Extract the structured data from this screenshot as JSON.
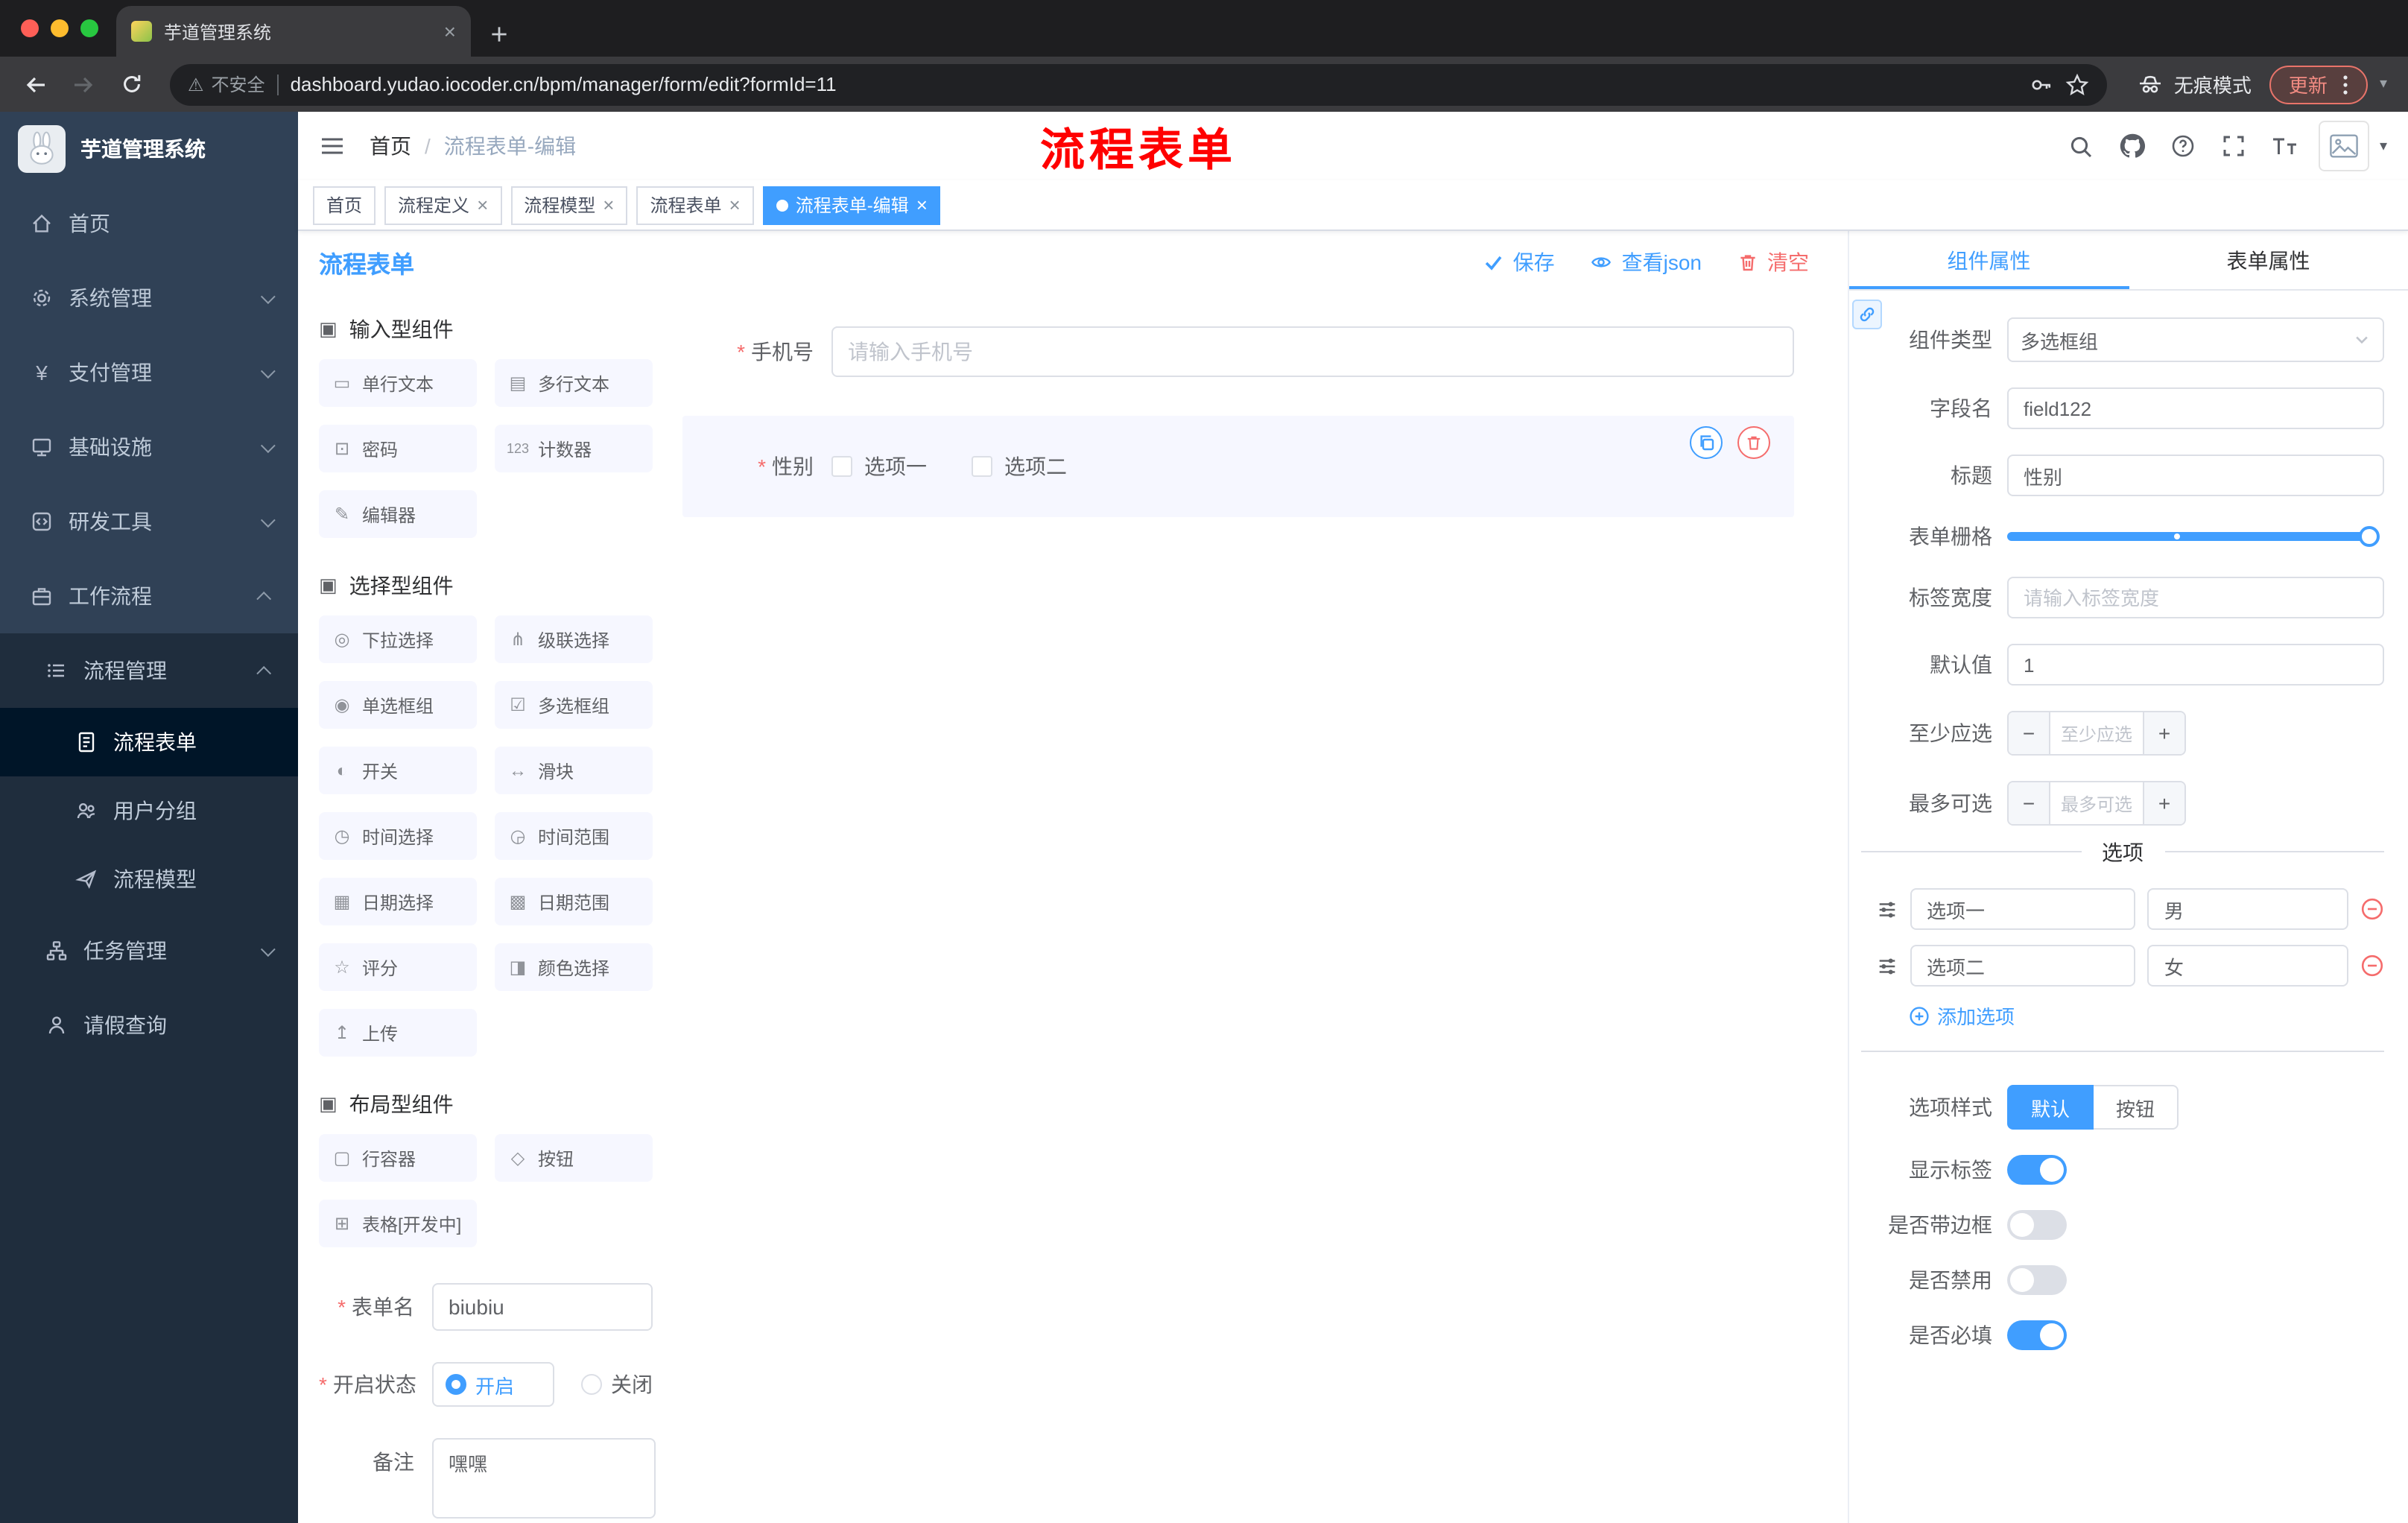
{
  "glyphs": {
    "close": "×",
    "caret_down": "▾",
    "warning": "⚠",
    "minus": "−",
    "plus": "+",
    "yen": "¥"
  },
  "browser": {
    "tab_title": "芋道管理系统",
    "security_label": "不安全",
    "url": "dashboard.yudao.iocoder.cn/bpm/manager/form/edit?formId=11",
    "incognito_label": "无痕模式",
    "update_label": "更新"
  },
  "sidebar": {
    "brand": "芋道管理系统",
    "items": [
      {
        "label": "首页"
      },
      {
        "label": "系统管理"
      },
      {
        "label": "支付管理"
      },
      {
        "label": "基础设施"
      },
      {
        "label": "研发工具"
      },
      {
        "label": "工作流程"
      },
      {
        "label": "流程管理"
      },
      {
        "label": "流程表单"
      },
      {
        "label": "用户分组"
      },
      {
        "label": "流程模型"
      },
      {
        "label": "任务管理"
      },
      {
        "label": "请假查询"
      }
    ]
  },
  "header": {
    "breadcrumb": {
      "home": "首页",
      "sep": "/",
      "current": "流程表单-编辑"
    },
    "annotation": "流程表单"
  },
  "tags": [
    {
      "label": "首页"
    },
    {
      "label": "流程定义"
    },
    {
      "label": "流程模型"
    },
    {
      "label": "流程表单"
    },
    {
      "label": "流程表单-编辑"
    }
  ],
  "designer": {
    "title": "流程表单",
    "actions": {
      "save": "保存",
      "view_json": "查看json",
      "clear": "清空"
    },
    "palette": {
      "sections": [
        {
          "title": "输入型组件",
          "glyph": "▣",
          "items": [
            {
              "glyph": "▭",
              "label": "单行文本"
            },
            {
              "glyph": "▤",
              "label": "多行文本"
            },
            {
              "glyph": "⊡",
              "label": "密码"
            },
            {
              "glyph": "123",
              "label": "计数器"
            },
            {
              "glyph": "✎",
              "label": "编辑器"
            }
          ]
        },
        {
          "title": "选择型组件",
          "glyph": "▣",
          "items": [
            {
              "glyph": "◎",
              "label": "下拉选择"
            },
            {
              "glyph": "⋔",
              "label": "级联选择"
            },
            {
              "glyph": "◉",
              "label": "单选框组"
            },
            {
              "glyph": "☑",
              "label": "多选框组"
            },
            {
              "glyph": "◐",
              "label": "开关"
            },
            {
              "glyph": "↔",
              "label": "滑块"
            },
            {
              "glyph": "◷",
              "label": "时间选择"
            },
            {
              "glyph": "◶",
              "label": "时间范围"
            },
            {
              "glyph": "▦",
              "label": "日期选择"
            },
            {
              "glyph": "▩",
              "label": "日期范围"
            },
            {
              "glyph": "☆",
              "label": "评分"
            },
            {
              "glyph": "◨",
              "label": "颜色选择"
            },
            {
              "glyph": "↥",
              "label": "上传"
            }
          ]
        },
        {
          "title": "布局型组件",
          "glyph": "▣",
          "items": [
            {
              "glyph": "▢",
              "label": "行容器"
            },
            {
              "glyph": "◇",
              "label": "按钮"
            },
            {
              "glyph": "⊞",
              "label": "表格[开发中]"
            }
          ]
        }
      ]
    },
    "meta_form": {
      "name_label": "表单名",
      "name_value": "biubiu",
      "status_label": "开启状态",
      "status_on": "开启",
      "status_off": "关闭",
      "remark_label": "备注",
      "remark_value": "嘿嘿"
    },
    "canvas": {
      "phone": {
        "label": "手机号",
        "placeholder": "请输入手机号"
      },
      "gender": {
        "label": "性别",
        "options": [
          {
            "label": "选项一"
          },
          {
            "label": "选项二"
          }
        ]
      }
    }
  },
  "props": {
    "tabs": {
      "component": "组件属性",
      "form": "表单属性"
    },
    "fields": {
      "type_label": "组件类型",
      "type_value": "多选框组",
      "field_label": "字段名",
      "field_value": "field122",
      "title_label": "标题",
      "title_value": "性别",
      "grid_label": "表单栅格",
      "label_width_label": "标签宽度",
      "label_width_placeholder": "请输入标签宽度",
      "default_label": "默认值",
      "default_value": "1",
      "min_label": "至少应选",
      "min_placeholder": "至少应选",
      "max_label": "最多可选",
      "max_placeholder": "最多可选"
    },
    "options": {
      "divider": "选项",
      "rows": [
        {
          "name": "选项一",
          "value": "男"
        },
        {
          "name": "选项二",
          "value": "女"
        }
      ],
      "add": "添加选项"
    },
    "style": {
      "label": "选项样式",
      "default": "默认",
      "button": "按钮"
    },
    "switches": [
      {
        "label": "显示标签"
      },
      {
        "label": "是否带边框"
      },
      {
        "label": "是否禁用"
      },
      {
        "label": "是否必填"
      }
    ]
  }
}
